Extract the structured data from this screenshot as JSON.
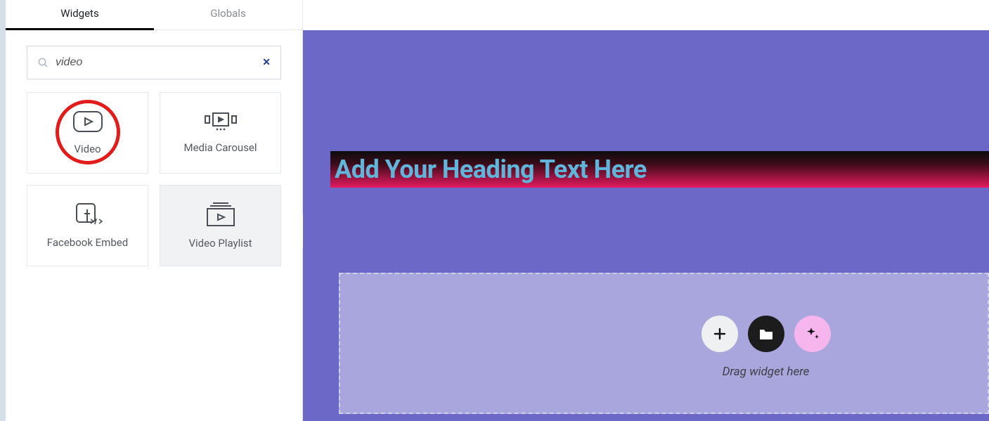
{
  "sidebar": {
    "tabs": {
      "widgets": "Widgets",
      "globals": "Globals"
    },
    "search": {
      "value": "video"
    },
    "widgets": [
      {
        "name": "video",
        "label": "Video"
      },
      {
        "name": "media-carousel",
        "label": "Media Carousel"
      },
      {
        "name": "facebook-embed",
        "label": "Facebook Embed"
      },
      {
        "name": "video-playlist",
        "label": "Video Playlist"
      }
    ]
  },
  "canvas": {
    "heading": "Add Your Heading Text Here",
    "dropzone_label": "Drag widget here"
  }
}
